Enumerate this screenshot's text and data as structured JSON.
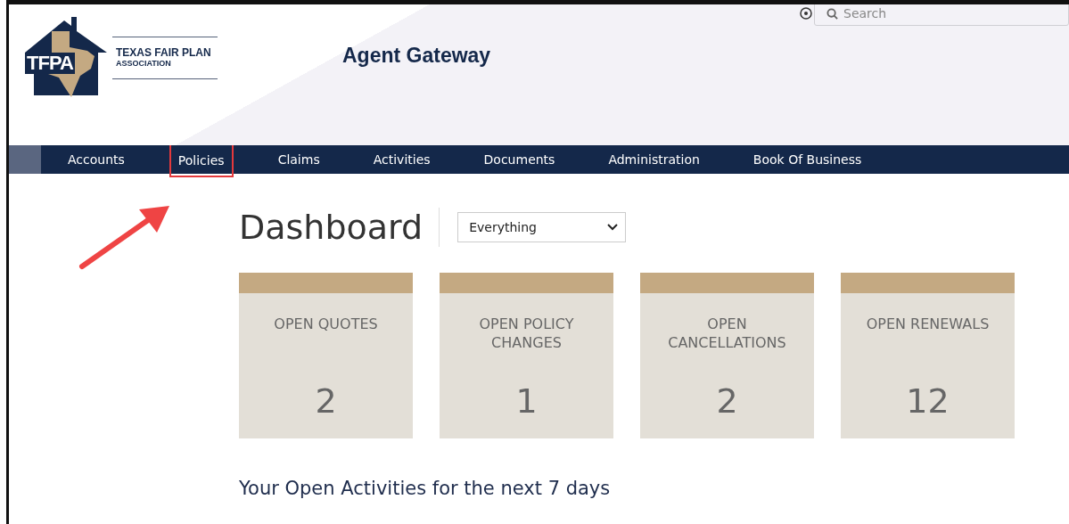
{
  "header": {
    "logo": {
      "mark": "TFPA",
      "name_line_1": "TEXAS FAIR PLAN",
      "name_line_2": "ASSOCIATION"
    },
    "title": "Agent Gateway",
    "search": {
      "placeholder": "Search"
    }
  },
  "nav": {
    "items": [
      {
        "label": "Accounts",
        "highlighted": false
      },
      {
        "label": "Policies",
        "highlighted": true
      },
      {
        "label": "Claims",
        "highlighted": false
      },
      {
        "label": "Activities",
        "highlighted": false
      },
      {
        "label": "Documents",
        "highlighted": false
      },
      {
        "label": "Administration",
        "highlighted": false
      },
      {
        "label": "Book Of Business",
        "highlighted": false
      }
    ]
  },
  "dashboard": {
    "title": "Dashboard",
    "filter": {
      "value": "Everything"
    },
    "cards": [
      {
        "label": "OPEN QUOTES",
        "count": "2"
      },
      {
        "label": "OPEN POLICY CHANGES",
        "count": "1"
      },
      {
        "label": "OPEN CANCELLATIONS",
        "count": "2"
      },
      {
        "label": "OPEN RENEWALS",
        "count": "12"
      }
    ],
    "activities_heading": "Your Open Activities for the next 7 days"
  }
}
